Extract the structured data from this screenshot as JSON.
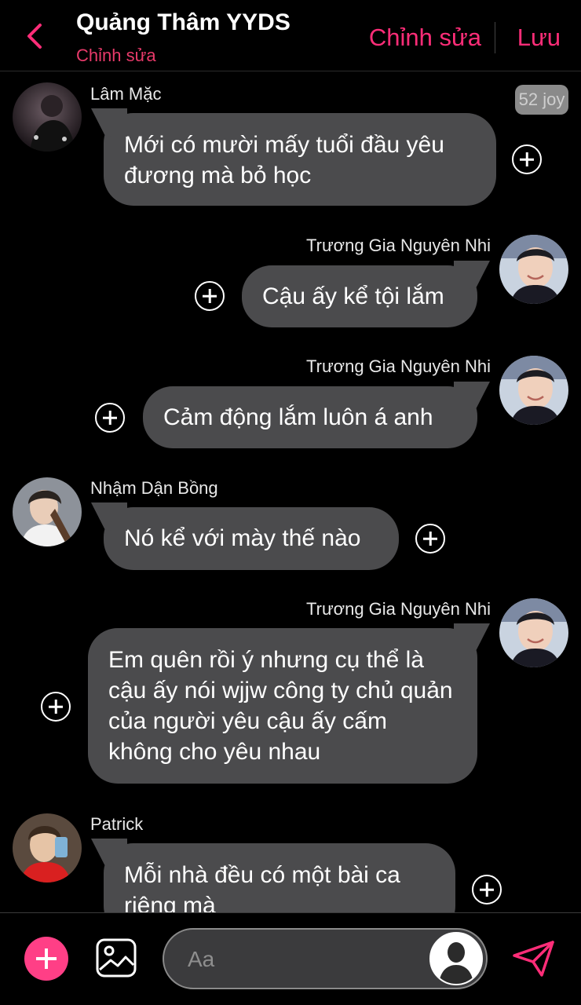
{
  "header": {
    "title": "Quảng Thâm YYDS",
    "subtitle": "Chỉnh sửa",
    "edit_label": "Chỉnh sửa",
    "save_label": "Lưu"
  },
  "joy_badge": "52 joy",
  "messages": [
    {
      "sender": "Lâm Mặc",
      "text": "Mới có mười mấy tuổi đầu yêu đương mà bỏ học",
      "side": "left"
    },
    {
      "sender": "Trương Gia Nguyên Nhi",
      "text": "Cậu ấy kể tội lắm",
      "side": "right"
    },
    {
      "sender": "Trương Gia Nguyên Nhi",
      "text": "Cảm động lắm luôn á anh",
      "side": "right"
    },
    {
      "sender": "Nhậm Dận Bồng",
      "text": "Nó kể với mày thế nào",
      "side": "left"
    },
    {
      "sender": "Trương Gia Nguyên Nhi",
      "text": "Em quên rồi ý nhưng cụ thể là cậu ấy nói wjjw công ty chủ quản của người yêu cậu ấy cấm không cho yêu nhau",
      "side": "right"
    },
    {
      "sender": "Patrick",
      "text": "Mỗi nhà đều có một bài ca riêng mà",
      "side": "left"
    }
  ],
  "composer": {
    "placeholder": "Aa"
  },
  "colors": {
    "accent": "#ff2d78",
    "subtitle": "#e83a6a",
    "bubble": "#4b4b4d",
    "background": "#000000"
  },
  "icons": {
    "back": "chevron-left-icon",
    "add_reaction": "plus-circle-icon",
    "add": "plus-icon",
    "image": "image-icon",
    "send": "send-icon",
    "profile": "person-silhouette-icon"
  }
}
